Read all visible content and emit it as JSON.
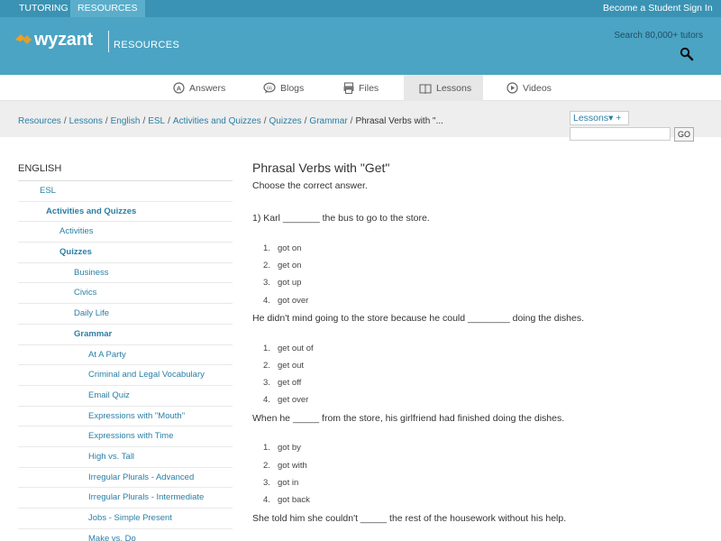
{
  "topbar": {
    "tabs": [
      {
        "label": "TUTORING"
      },
      {
        "label": "RESOURCES"
      }
    ],
    "links": [
      {
        "label": "Become a Student"
      },
      {
        "label": "Sign In"
      }
    ]
  },
  "header": {
    "logo_text": "wyzant",
    "logo_section": "RESOURCES",
    "search_label": "Search 80,000+ tutors"
  },
  "nav": {
    "items": [
      {
        "label": "Answers",
        "icon": "answers-icon"
      },
      {
        "label": "Blogs",
        "icon": "blogs-icon"
      },
      {
        "label": "Files",
        "icon": "files-icon"
      },
      {
        "label": "Lessons",
        "icon": "lessons-icon",
        "active": true
      },
      {
        "label": "Videos",
        "icon": "videos-icon"
      }
    ]
  },
  "breadcrumb": {
    "links": [
      "Resources",
      "Lessons",
      "English",
      "ESL",
      "Activities and Quizzes",
      "Quizzes",
      "Grammar"
    ],
    "current": "Phrasal Verbs with \"..."
  },
  "lessons_search": {
    "dropdown_label": "Lessons▾ +",
    "go_label": "GO",
    "input_value": ""
  },
  "sidebar": {
    "heading": "ENGLISH",
    "items": [
      {
        "label": "ESL",
        "level": 1
      },
      {
        "label": "Activities and Quizzes",
        "level": 2
      },
      {
        "label": "Activities",
        "level": 3
      },
      {
        "label": "Quizzes",
        "level": 3
      },
      {
        "label": "Business",
        "level": 4
      },
      {
        "label": "Civics",
        "level": 4
      },
      {
        "label": "Daily Life",
        "level": 4
      },
      {
        "label": "Grammar",
        "level": 4
      },
      {
        "label": "At A Party",
        "level": 5
      },
      {
        "label": "Criminal and Legal Vocabulary",
        "level": 5
      },
      {
        "label": "Email Quiz",
        "level": 5
      },
      {
        "label": "Expressions with \"Mouth\"",
        "level": 5
      },
      {
        "label": "Expressions with Time",
        "level": 5
      },
      {
        "label": "High vs. Tall",
        "level": 5
      },
      {
        "label": "Irregular Plurals - Advanced",
        "level": 5
      },
      {
        "label": "Irregular Plurals - Intermediate",
        "level": 5
      },
      {
        "label": "Jobs - Simple Present",
        "level": 5
      },
      {
        "label": "Make vs. Do",
        "level": 5
      }
    ]
  },
  "lesson": {
    "title": "Phrasal Verbs with \"Get\"",
    "instruction": "Choose the correct answer.",
    "questions": [
      {
        "text": "1) Karl _______ the bus to go to the store.",
        "options": [
          "got on",
          "get on",
          "got up",
          "got over"
        ]
      },
      {
        "text": "He didn't mind going to the store because he could ________ doing the dishes.",
        "options": [
          "get out of",
          "get out",
          "get off",
          "get over"
        ]
      },
      {
        "text": "When he _____ from the store, his girlfriend had finished doing the dishes.",
        "options": [
          "got by",
          "got with",
          "got in",
          "got back"
        ]
      },
      {
        "text": "She told him she couldn't _____ the rest of the housework without his help.",
        "options": []
      }
    ]
  },
  "colors": {
    "topbar": "#3a93b4",
    "header": "#4ba4c4",
    "link": "#2a7fa5",
    "logo_orange": "#f6a01a"
  }
}
